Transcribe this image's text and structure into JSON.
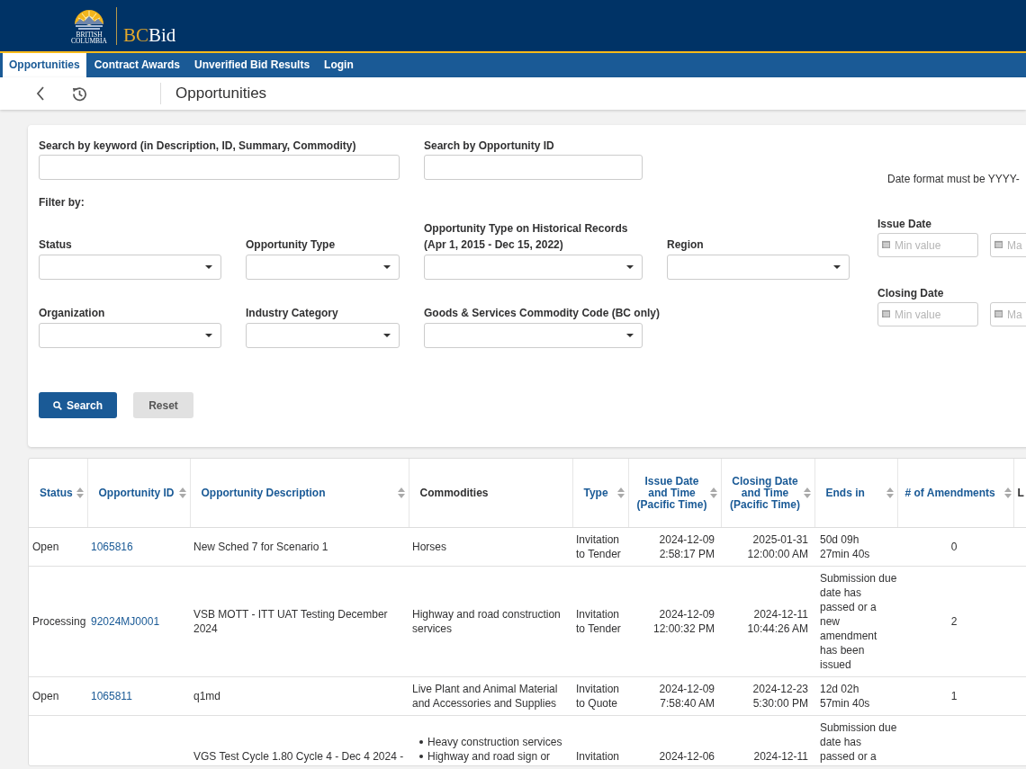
{
  "header": {
    "logo_lines": [
      "BRITISH",
      "COLUMBIA"
    ],
    "brand": {
      "accent": "BC",
      "rest": "Bid"
    }
  },
  "nav": [
    {
      "label": "Opportunities",
      "selected": true
    },
    {
      "label": "Contract Awards",
      "selected": false
    },
    {
      "label": "Unverified Bid Results",
      "selected": false
    },
    {
      "label": "Login",
      "selected": false
    }
  ],
  "toolbar": {
    "title": "Opportunities"
  },
  "search": {
    "keyword": {
      "label": "Search by keyword (in Description, ID, Summary, Commodity)"
    },
    "opportunity_id": {
      "label": "Search by Opportunity ID"
    },
    "date_note": "Date format must be YYYY-",
    "filter_label": "Filter by:",
    "filters": [
      [
        {
          "label": "Status"
        },
        {
          "label": "Opportunity Type"
        },
        {
          "label": "Opportunity Type on Historical Records (Apr 1, 2015 - Dec 15, 2022)"
        },
        {
          "label": "Region"
        }
      ],
      [
        {
          "label": "Organization"
        },
        {
          "label": "Industry Category"
        },
        {
          "label": "Goods & Services Commodity Code (BC only)"
        }
      ]
    ],
    "date_filters": [
      {
        "label": "Issue Date",
        "min_placeholder": "Min value",
        "max_placeholder": "Ma"
      },
      {
        "label": "Closing Date",
        "min_placeholder": "Min value",
        "max_placeholder": "Ma"
      }
    ],
    "buttons": [
      {
        "label": "Search",
        "kind": "primary"
      },
      {
        "label": "Reset",
        "kind": "secondary"
      }
    ]
  },
  "table": {
    "columns": [
      {
        "label": "Status",
        "sortable": true
      },
      {
        "label": "Opportunity ID",
        "sortable": true
      },
      {
        "label": "Opportunity Description",
        "sortable": true
      },
      {
        "label": "Commodities",
        "sortable": false
      },
      {
        "label": "Type",
        "sortable": true
      },
      {
        "label": "Issue Date and Time (Pacific Time)",
        "sortable": true
      },
      {
        "label": "Closing Date and Time (Pacific Time)",
        "sortable": true
      },
      {
        "label": "Ends in",
        "sortable": true
      },
      {
        "label": "# of Amendments",
        "sortable": true
      },
      {
        "label": "L"
      }
    ],
    "rows": [
      {
        "status": "Open",
        "opportunity_id": "1065816",
        "description": "New Sched 7 for Scenario 1",
        "commodities": [
          "Horses"
        ],
        "type": "Invitation to Tender",
        "issue_date": "2024-12-09 2:58:17 PM",
        "closing_date": "2025-01-31 12:00:00 AM",
        "ends_in": {
          "kind": "countdown",
          "lines": [
            "50d 09h",
            "27min 40s"
          ]
        },
        "amendments": "0"
      },
      {
        "status": "Processing",
        "opportunity_id": "92024MJ0001",
        "description": "VSB MOTT - ITT UAT Testing December 2024",
        "commodities": [
          "Highway and road construction services"
        ],
        "type": "Invitation to Tender",
        "issue_date": "2024-12-09 12:00:32 PM",
        "closing_date": "2024-12-11 10:44:26 AM",
        "ends_in": {
          "kind": "notice",
          "text": "Submission due date has passed or a new amendment has been issued"
        },
        "amendments": "2"
      },
      {
        "status": "Open",
        "opportunity_id": "1065811",
        "description": "q1md",
        "commodities": [
          "Live Plant and Animal Material and Accessories and Supplies"
        ],
        "type": "Invitation to Quote",
        "issue_date": "2024-12-09 7:58:40 AM",
        "closing_date": "2024-12-23 5:30:00 PM",
        "ends_in": {
          "kind": "countdown",
          "lines": [
            "12d 02h",
            "57min 40s"
          ]
        },
        "amendments": "1"
      },
      {
        "description": "VGS Test Cycle 1.80 Cycle 4 - Dec 4 2024 -",
        "commodities": [
          "Heavy construction services",
          "Highway and road sign or"
        ],
        "type": "Invitation",
        "issue_date": "2024-12-06",
        "closing_date": "2024-12-11",
        "ends_in": {
          "kind": "notice",
          "text": "Submission due date has passed or a"
        }
      }
    ]
  }
}
